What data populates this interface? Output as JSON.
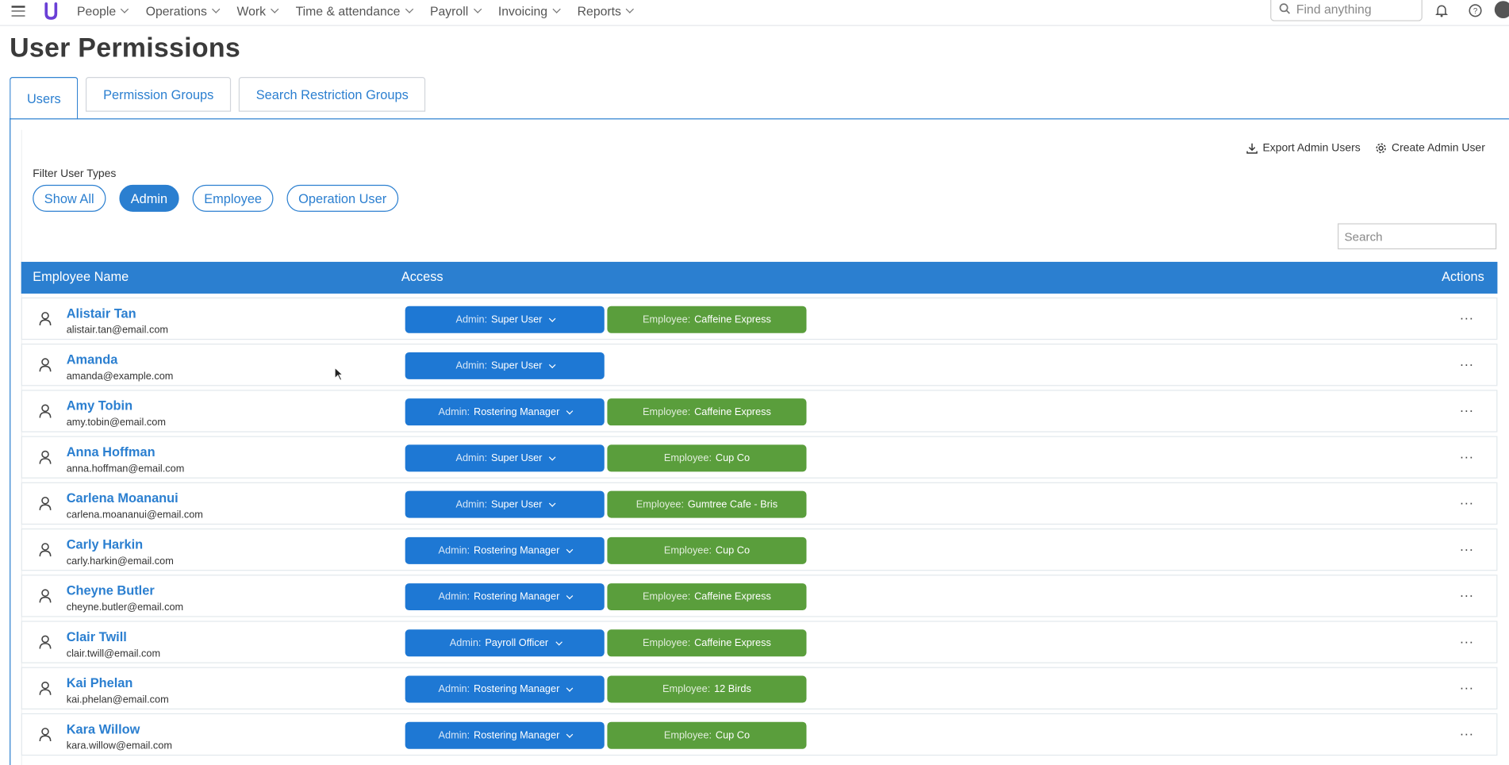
{
  "nav": {
    "items": [
      {
        "label": "People"
      },
      {
        "label": "Operations"
      },
      {
        "label": "Work"
      },
      {
        "label": "Time & attendance"
      },
      {
        "label": "Payroll"
      },
      {
        "label": "Invoicing"
      },
      {
        "label": "Reports"
      }
    ],
    "search_placeholder": "Find anything"
  },
  "page": {
    "title": "User Permissions"
  },
  "tabs": [
    {
      "label": "Users",
      "active": true
    },
    {
      "label": "Permission Groups",
      "active": false
    },
    {
      "label": "Search Restriction Groups",
      "active": false
    }
  ],
  "toolbar": {
    "export_label": "Export Admin Users",
    "create_label": "Create Admin User"
  },
  "filter": {
    "label": "Filter User Types",
    "options": [
      {
        "label": "Show All",
        "active": false
      },
      {
        "label": "Admin",
        "active": true
      },
      {
        "label": "Employee",
        "active": false
      },
      {
        "label": "Operation User",
        "active": false
      }
    ]
  },
  "search": {
    "placeholder": "Search"
  },
  "table": {
    "headers": {
      "name": "Employee Name",
      "access": "Access",
      "actions": "Actions"
    },
    "rows": [
      {
        "name": "Alistair Tan",
        "email": "alistair.tan@email.com",
        "admin_key": "Admin:",
        "admin_role": "Super User",
        "emp_key": "Employee:",
        "emp_company": "Caffeine Express"
      },
      {
        "name": "Amanda",
        "email": "amanda@example.com",
        "admin_key": "Admin:",
        "admin_role": "Super User",
        "emp_key": "",
        "emp_company": ""
      },
      {
        "name": "Amy Tobin",
        "email": "amy.tobin@email.com",
        "admin_key": "Admin:",
        "admin_role": "Rostering Manager",
        "emp_key": "Employee:",
        "emp_company": "Caffeine Express"
      },
      {
        "name": "Anna Hoffman",
        "email": "anna.hoffman@email.com",
        "admin_key": "Admin:",
        "admin_role": "Super User",
        "emp_key": "Employee:",
        "emp_company": "Cup Co"
      },
      {
        "name": "Carlena Moananui",
        "email": "carlena.moananui@email.com",
        "admin_key": "Admin:",
        "admin_role": "Super User",
        "emp_key": "Employee:",
        "emp_company": "Gumtree Cafe - Bris"
      },
      {
        "name": "Carly Harkin",
        "email": "carly.harkin@email.com",
        "admin_key": "Admin:",
        "admin_role": "Rostering Manager",
        "emp_key": "Employee:",
        "emp_company": "Cup Co"
      },
      {
        "name": "Cheyne Butler",
        "email": "cheyne.butler@email.com",
        "admin_key": "Admin:",
        "admin_role": "Rostering Manager",
        "emp_key": "Employee:",
        "emp_company": "Caffeine Express"
      },
      {
        "name": "Clair Twill",
        "email": "clair.twill@email.com",
        "admin_key": "Admin:",
        "admin_role": "Payroll Officer",
        "emp_key": "Employee:",
        "emp_company": "Caffeine Express"
      },
      {
        "name": "Kai Phelan",
        "email": "kai.phelan@email.com",
        "admin_key": "Admin:",
        "admin_role": "Rostering Manager",
        "emp_key": "Employee:",
        "emp_company": "12 Birds"
      },
      {
        "name": "Kara Willow",
        "email": "kara.willow@email.com",
        "admin_key": "Admin:",
        "admin_role": "Rostering Manager",
        "emp_key": "Employee:",
        "emp_company": "Cup Co"
      }
    ],
    "row_actions_label": "..."
  },
  "colors": {
    "primary": "#2b7fd0",
    "admin_badge": "#1e78d4",
    "employee_badge": "#5a9e3c"
  },
  "icons": [
    "hamburger-icon",
    "logo-icon",
    "search-icon",
    "bell-icon",
    "help-icon",
    "user-avatar",
    "download-icon",
    "gear-icon",
    "person-icon",
    "more-icon"
  ]
}
